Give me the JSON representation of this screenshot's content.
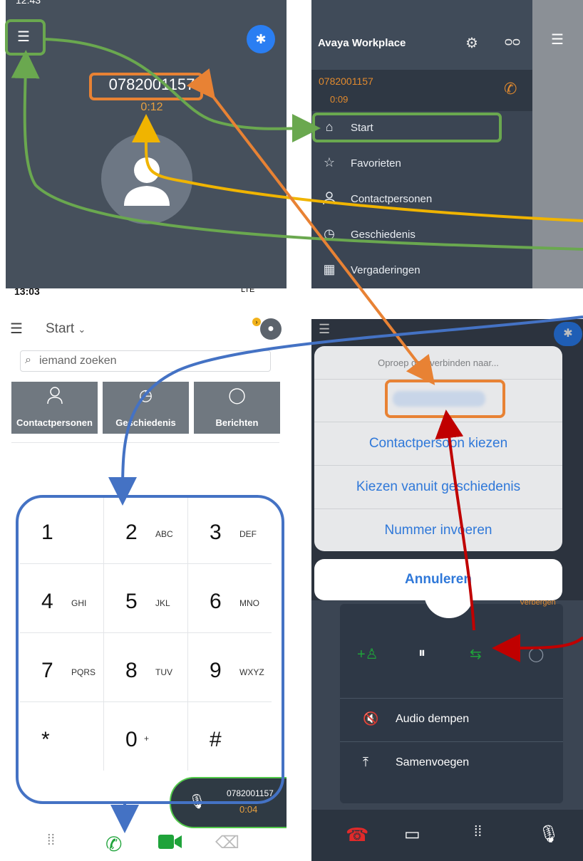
{
  "colors": {
    "panel_dark": "#46505c",
    "menu_bg": "#3b4553",
    "accent_orange": "#e28a2e",
    "ios_blue": "#2f78d9",
    "green": "#1fa33a",
    "red": "#e02a2a",
    "annot_green": "#6aa84f",
    "annot_orange": "#e88234",
    "annot_yellow": "#f0b400",
    "annot_blue": "#4472c4",
    "annot_red": "#c00000"
  },
  "panel1": {
    "status_time": "12:43",
    "menu_icon": "hamburger-icon",
    "phone_number": "0782001157",
    "call_timer": "0:12",
    "bluetooth_icon": "bluetooth-headset-icon"
  },
  "panel2": {
    "app_title": "Avaya Workplace",
    "settings_icon": "gear-icon",
    "voicemail_icon": "voicemail-icon",
    "active_call": {
      "number": "0782001157",
      "timer": "0:09"
    },
    "nav": [
      {
        "icon": "home-icon",
        "label": "Start"
      },
      {
        "icon": "star-icon",
        "label": "Favorieten"
      },
      {
        "icon": "person-icon",
        "label": "Contactpersonen"
      },
      {
        "icon": "clock-icon",
        "label": "Geschiedenis"
      },
      {
        "icon": "calendar-icon",
        "label": "Vergaderingen"
      }
    ]
  },
  "panel3": {
    "status_time": "13:03",
    "status_right": "LTE",
    "header_title": "Start",
    "search_placeholder": "iemand zoeken",
    "quick_buttons": [
      {
        "icon": "person-icon",
        "label": "Contactpersonen"
      },
      {
        "icon": "clock-icon",
        "label": "Geschiedenis"
      },
      {
        "icon": "chat-bubble-icon",
        "label": "Berichten"
      }
    ],
    "keypad": [
      {
        "digit": "1",
        "letters": ""
      },
      {
        "digit": "2",
        "letters": "ABC"
      },
      {
        "digit": "3",
        "letters": "DEF"
      },
      {
        "digit": "4",
        "letters": "GHI"
      },
      {
        "digit": "5",
        "letters": "JKL"
      },
      {
        "digit": "6",
        "letters": "MNO"
      },
      {
        "digit": "7",
        "letters": "PQRS"
      },
      {
        "digit": "8",
        "letters": "TUV"
      },
      {
        "digit": "9",
        "letters": "WXYZ"
      },
      {
        "digit": "*",
        "letters": ""
      },
      {
        "digit": "0",
        "letters": "+"
      },
      {
        "digit": "#",
        "letters": ""
      }
    ],
    "active_call_pill": {
      "number": "0782001157",
      "timer": "0:04"
    }
  },
  "panel4": {
    "sheet_title": "Oproep doorverbinden naar...",
    "options": [
      "Contactpersoon kiezen",
      "Kiezen vanuit geschiedenis",
      "Nummer invoeren"
    ],
    "cancel": "Annuleren",
    "hide_label": "Verbergen",
    "menu_list": [
      {
        "icon": "speaker-muted-icon",
        "label": "Audio dempen"
      },
      {
        "icon": "merge-icon",
        "label": "Samenvoegen"
      }
    ]
  }
}
